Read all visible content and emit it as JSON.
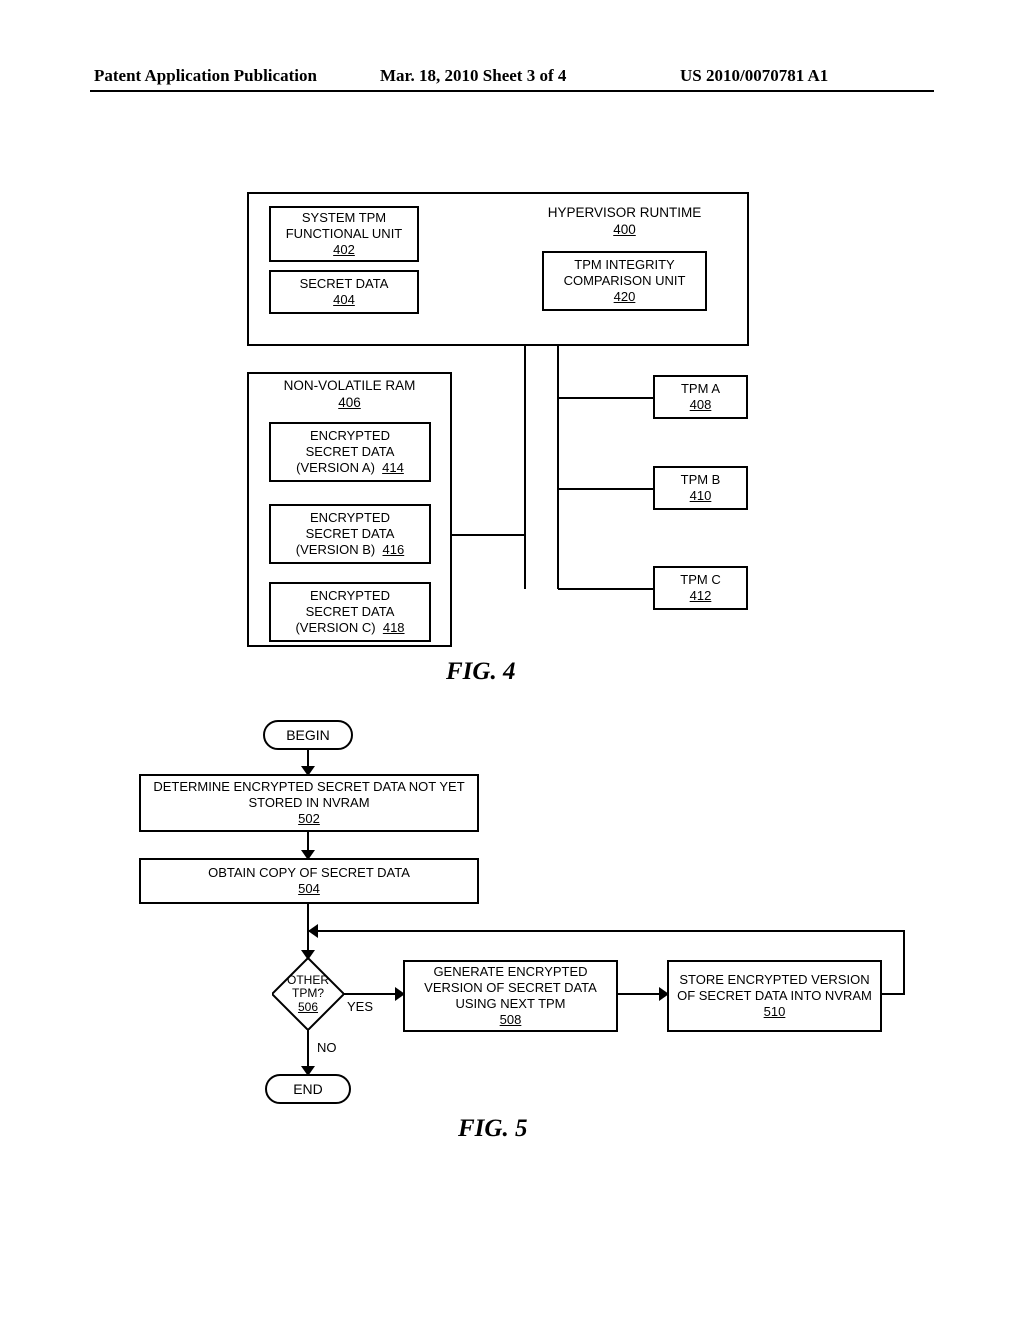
{
  "header": {
    "left": "Patent Application Publication",
    "mid": "Mar. 18, 2010  Sheet 3 of 4",
    "right": "US 2010/0070781 A1"
  },
  "fig4": {
    "caption": "FIG. 4",
    "hypervisor": {
      "label": "HYPERVISOR RUNTIME",
      "ref": "400"
    },
    "sysunit": {
      "label": "SYSTEM TPM FUNCTIONAL UNIT",
      "ref": "402"
    },
    "secret": {
      "label": "SECRET DATA",
      "ref": "404"
    },
    "integrity": {
      "label": "TPM INTEGRITY COMPARISON UNIT",
      "ref": "420"
    },
    "nvram": {
      "label": "NON-VOLATILE RAM",
      "ref": "406"
    },
    "enc_a": {
      "l1": "ENCRYPTED",
      "l2": "SECRET DATA",
      "l3": "(VERSION A)",
      "ref": "414"
    },
    "enc_b": {
      "l1": "ENCRYPTED",
      "l2": "SECRET DATA",
      "l3": "(VERSION B)",
      "ref": "416"
    },
    "enc_c": {
      "l1": "ENCRYPTED",
      "l2": "SECRET DATA",
      "l3": "(VERSION C)",
      "ref": "418"
    },
    "tpm_a": {
      "label": "TPM A",
      "ref": "408"
    },
    "tpm_b": {
      "label": "TPM B",
      "ref": "410"
    },
    "tpm_c": {
      "label": "TPM C",
      "ref": "412"
    }
  },
  "fig5": {
    "caption": "FIG. 5",
    "begin": "BEGIN",
    "end": "END",
    "step502": {
      "label": "DETERMINE ENCRYPTED SECRET DATA NOT YET STORED IN NVRAM",
      "ref": "502"
    },
    "step504": {
      "label": "OBTAIN COPY OF SECRET DATA",
      "ref": "504"
    },
    "decision506": {
      "l1": "OTHER",
      "l2": "TPM?",
      "ref": "506"
    },
    "yes": "YES",
    "no": "NO",
    "step508": {
      "label": "GENERATE ENCRYPTED VERSION OF SECRET DATA USING NEXT TPM",
      "ref": "508"
    },
    "step510": {
      "label": "STORE ENCRYPTED VERSION OF SECRET DATA INTO NVRAM",
      "ref": "510"
    }
  }
}
